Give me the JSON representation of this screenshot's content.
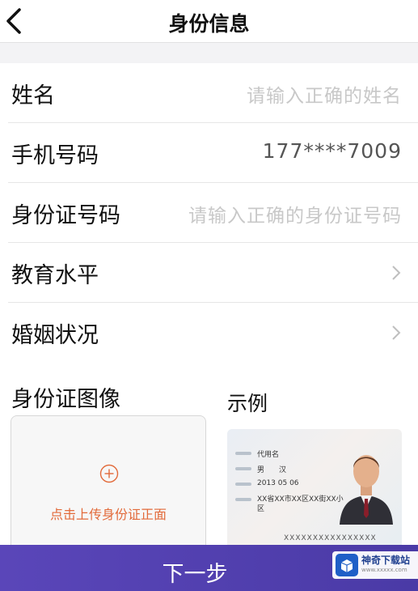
{
  "header": {
    "title": "身份信息"
  },
  "form": {
    "name": {
      "label": "姓名",
      "placeholder": "请输入正确的姓名"
    },
    "phone": {
      "label": "手机号码",
      "value": "177****7009"
    },
    "id_number": {
      "label": "身份证号码",
      "placeholder": "请输入正确的身份证号码"
    },
    "education": {
      "label": "教育水平"
    },
    "marital": {
      "label": "婚姻状况"
    }
  },
  "id_image": {
    "title": "身份证图像",
    "upload_label": "点击上传身份证正面",
    "example_title": "示例",
    "example_card": {
      "name": "代用名",
      "gender": "男",
      "ethnicity": "汉",
      "birth": "2013  05  06",
      "address": "XX省XX市XX区XX街XX小区",
      "id_number": "XXXXXXXXXXXXXXXX"
    }
  },
  "footer": {
    "next_label": "下一步"
  },
  "watermark": {
    "text": "神奇下载站",
    "url": "www.xxxxx.com"
  },
  "colors": {
    "accent": "#5a46b9",
    "upload_text": "#e26a3a"
  }
}
